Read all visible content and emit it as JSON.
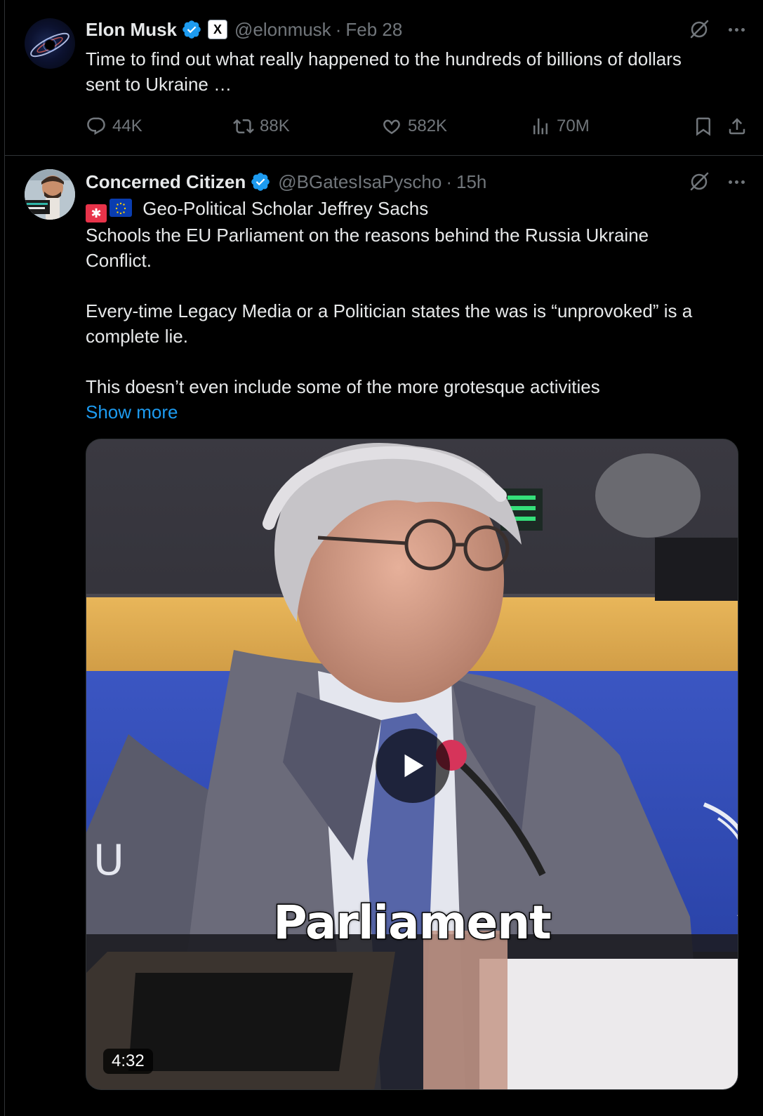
{
  "tweets": [
    {
      "author": {
        "name": "Elon Musk",
        "handle": "@elonmusk",
        "affiliation_badge": "X"
      },
      "time": "Feb 28",
      "text": [
        "Time to find out what really happened to the hundreds of billions of dollars",
        "sent to Ukraine …"
      ],
      "stats": {
        "replies": "44K",
        "reposts": "88K",
        "likes": "582K",
        "views": "70M"
      }
    },
    {
      "author": {
        "name": "Concerned Citizen",
        "handle": "@BGatesIsaPyscho"
      },
      "time": "15h",
      "text": [
        "Geo-Political Scholar Jeffrey Sachs",
        "Schools the EU Parliament on the reasons behind the Russia Ukraine",
        "Conflict.",
        "",
        "Every-time Legacy Media or a Politician states the was is “unprovoked” is a",
        "complete lie.",
        "",
        "This doesn’t even include some of the more grotesque activities"
      ],
      "show_more": "Show more",
      "video": {
        "caption": "Parliament",
        "duration": "4:32"
      }
    }
  ],
  "colors": {
    "background": "#000000",
    "text": "#e7e9ea",
    "muted": "#71767b",
    "link": "#1d9bf0",
    "verified": "#1d9bf0",
    "divider": "#2f3336"
  },
  "icons": [
    "verified-badge-icon",
    "x-logo-icon",
    "grok-icon",
    "more-icon",
    "reply-icon",
    "retweet-icon",
    "like-icon",
    "views-icon",
    "bookmark-icon",
    "share-icon",
    "play-icon"
  ]
}
